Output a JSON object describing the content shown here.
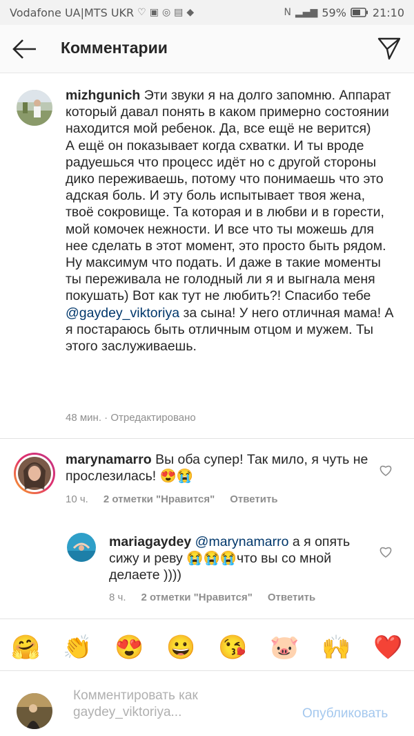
{
  "status_bar": {
    "carrier": "Vodafone UA|MTS UKR",
    "battery": "59%",
    "time": "21:10",
    "icons": [
      "heart-icon",
      "photo-icon",
      "instagram-icon",
      "now-live-icon",
      "shield-icon",
      "nfc-icon",
      "signal-icon",
      "battery-icon"
    ]
  },
  "header": {
    "title": "Комментарии",
    "back_icon": "back-arrow-icon",
    "send_icon": "send-icon"
  },
  "comments": [
    {
      "username": "mizhgunich",
      "text_parts": [
        " Эти звуки я на долго запомню. Аппарат который давал понять в каком примерно состоянии находится мой ребенок. Да, все ещё не верится)\nА ещё он показывает когда схватки. И ты вроде радуешься что процесс идёт но с другой стороны дико переживаешь, потому что понимаешь что это адская боль. И эту боль испытывает твоя жена, твоё сокровище. Та которая и в любви и в горести, мой комочек нежности. И все что ты можешь для нее сделать в этот момент, это просто быть рядом. Ну максимум что подать. И даже в такие моменты ты переживала не голодный ли я и выгнала меня покушать) Вот как тут не любить?! Спасибо тебе ",
        "@gaydey_viktoriya",
        " за сына! У него отличная мама! А я постараюсь быть отличным отцом и мужем. Ты этого заслуживаешь."
      ],
      "time": "48 мин.",
      "edited": "· Отредактировано"
    },
    {
      "username": "marynamarro",
      "text": " Вы оба супер! Так мило, я чуть не прослезилась! 😍😭",
      "time": "10 ч.",
      "likes": "2 отметки \"Нравится\"",
      "reply": "Ответить"
    },
    {
      "username": "mariagaydey",
      "mention": "@marynamarro",
      "text": " а я опять сижу и реву 😭😭😭что вы со мной делаете ))))",
      "time": "8 ч.",
      "likes": "2 отметки \"Нравится\"",
      "reply": "Ответить"
    }
  ],
  "emoji_bar": [
    "🤗",
    "👏",
    "😍",
    "😀",
    "😘",
    "🐷",
    "🙌",
    "❤️"
  ],
  "composer": {
    "placeholder": "Комментировать как\ngaydey_viktoriya...",
    "publish": "Опубликовать"
  }
}
